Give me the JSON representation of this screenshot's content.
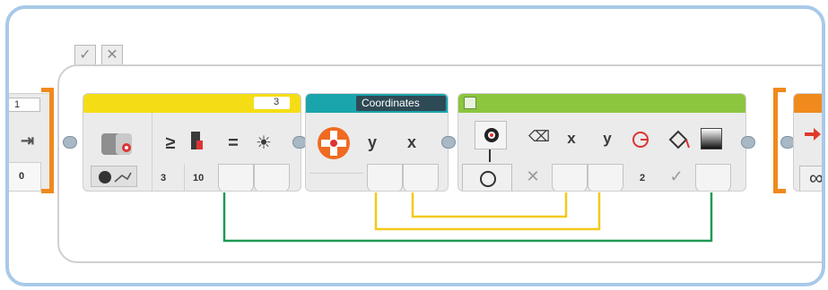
{
  "toolbar": {
    "check_icon": "✓",
    "close_icon": "✕"
  },
  "loop_start": {
    "counter_label": "1",
    "counter_value": "0",
    "icon": "loop-start-icon"
  },
  "sensor_block": {
    "header_number": "3",
    "port_label": "3",
    "compare_symbol": "≥",
    "threshold_value": "10",
    "equals_symbol": "=",
    "mode_icon": "brightness-icon",
    "sensor_icon": "color-sensor-icon",
    "measure_icon": "measure-mode-icon"
  },
  "coordinates_block": {
    "header_label": "Coordinates",
    "icon": "dpad-icon",
    "y_label": "y",
    "x_label": "x"
  },
  "display_block": {
    "x_label": "x",
    "y_label": "y",
    "radius_value": "2",
    "fill_check": "✓",
    "clear_icon": "eraser-icon",
    "circle_icon": "circle-icon",
    "radius_icon": "radius-icon",
    "fill_icon": "fill-icon",
    "color_icon": "color-swatch-icon",
    "mode_icon": "display-icon"
  },
  "loop_end": {
    "mode_symbol": "∞",
    "icon": "loop-end-icon"
  },
  "colors": {
    "frame_border": "#a9c9e8",
    "loop_orange": "#f08a1c",
    "sensor_header": "#f5dd16",
    "coord_header": "#1aa5ad",
    "display_header": "#8cc63f",
    "wire_yellow": "#f3c91b",
    "wire_green": "#1f9a55"
  }
}
